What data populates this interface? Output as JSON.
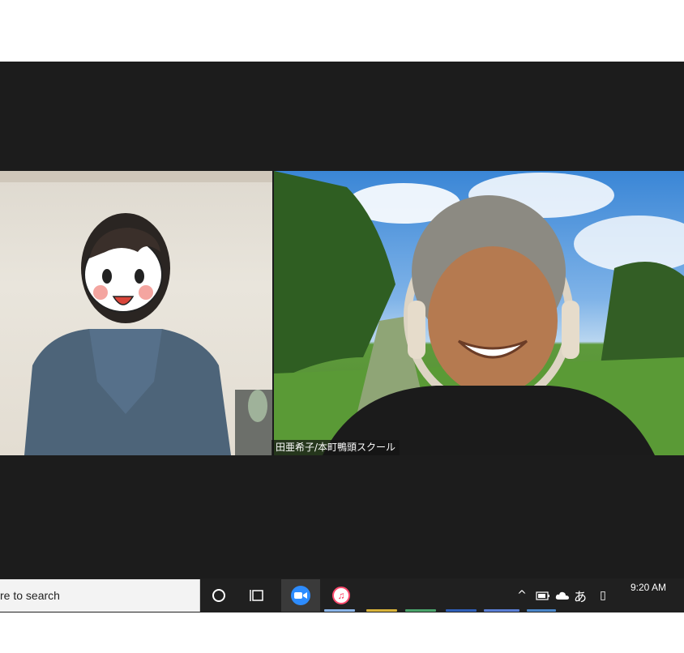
{
  "participants": [
    {
      "id": "left",
      "name_tag": ""
    },
    {
      "id": "right",
      "name_tag": "田亜希子/本町鴨頭スクール"
    }
  ],
  "taskbar": {
    "search_placeholder": "re to search",
    "apps": [
      "cortana-icon",
      "task-view-icon",
      "zoom-icon",
      "music-icon"
    ],
    "tray": {
      "chevron": "^",
      "ime_label": "あ",
      "notification_glyph": "▯"
    },
    "clock": {
      "time": "9:20 AM",
      "date": ""
    }
  },
  "colors": {
    "taskbar": "#202020",
    "zoom": "#2d8cff",
    "meeting_bg": "#1c1c1c"
  }
}
